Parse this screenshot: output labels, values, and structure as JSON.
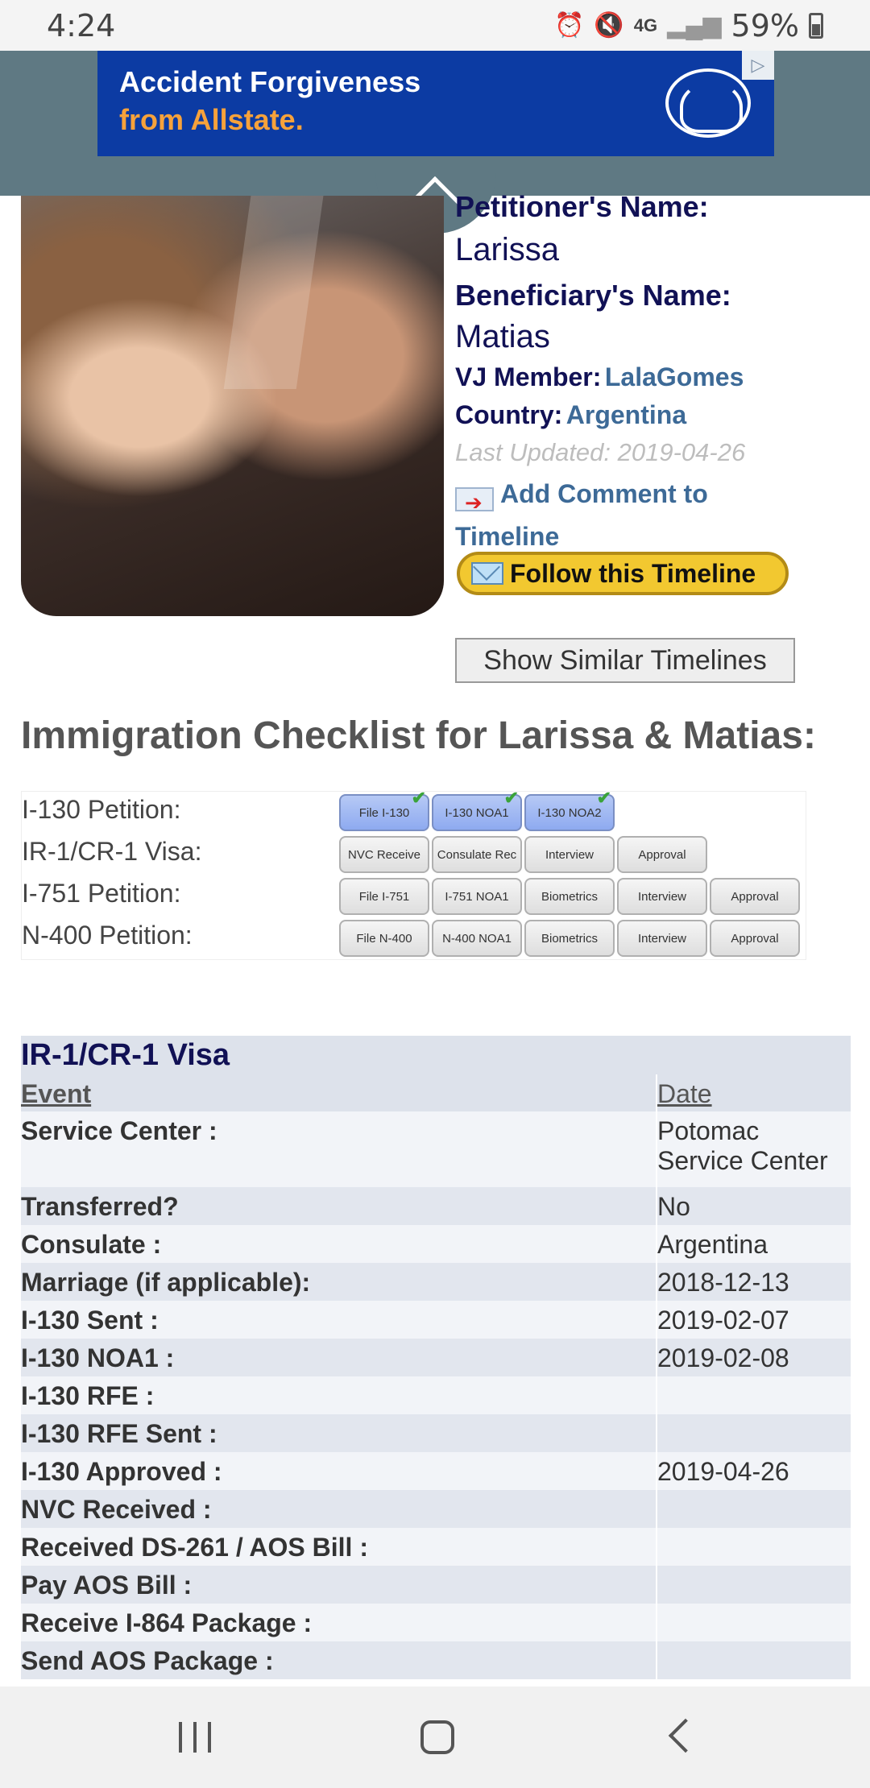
{
  "status": {
    "time": "4:24",
    "battery": "59%",
    "icons": [
      "alarm-icon",
      "mute-icon",
      "4g-lte-icon",
      "signal-icon",
      "battery-icon"
    ]
  },
  "ad": {
    "line1": "Accident Forgiveness",
    "line2": "from Allstate.",
    "brand_color": "#0c3ba3",
    "accent_color": "#f7a23b"
  },
  "profile": {
    "petitioner_label": "Petitioner's Name:",
    "petitioner": "Larissa",
    "beneficiary_label": "Beneficiary's Name:",
    "beneficiary": "Matias",
    "member_label": "VJ Member:",
    "member": "LalaGomes",
    "country_label": "Country:",
    "country": "Argentina",
    "last_updated": "Last Updated: 2019-04-26",
    "add_comment": "Add Comment to Timeline",
    "follow": "Follow this Timeline",
    "similar": "Show Similar Timelines"
  },
  "checklist": {
    "title": "Immigration Checklist for Larissa & Matias:",
    "rows": [
      {
        "label": "I-130 Petition:",
        "steps": [
          {
            "text": "File I-130",
            "done": true
          },
          {
            "text": "I-130 NOA1",
            "done": true
          },
          {
            "text": "I-130 NOA2",
            "done": true
          }
        ]
      },
      {
        "label": "IR-1/CR-1 Visa:",
        "steps": [
          {
            "text": "NVC Receive",
            "done": false
          },
          {
            "text": "Consulate Rec",
            "done": false
          },
          {
            "text": "Interview",
            "done": false
          },
          {
            "text": "Approval",
            "done": false
          }
        ]
      },
      {
        "label": "I-751 Petition:",
        "steps": [
          {
            "text": "File I-751",
            "done": false
          },
          {
            "text": "I-751 NOA1",
            "done": false
          },
          {
            "text": "Biometrics",
            "done": false
          },
          {
            "text": "Interview",
            "done": false
          },
          {
            "text": "Approval",
            "done": false
          }
        ]
      },
      {
        "label": "N-400 Petition:",
        "steps": [
          {
            "text": "File N-400",
            "done": false
          },
          {
            "text": "N-400 NOA1",
            "done": false
          },
          {
            "text": "Biometrics",
            "done": false
          },
          {
            "text": "Interview",
            "done": false
          },
          {
            "text": "Approval",
            "done": false
          }
        ]
      }
    ]
  },
  "events": {
    "title": "IR-1/CR-1 Visa",
    "header": {
      "event": "Event",
      "date": "Date"
    },
    "rows": [
      {
        "event": "Service Center :",
        "date": "Potomac Service Center"
      },
      {
        "event": "Transferred?",
        "date": "No"
      },
      {
        "event": "Consulate :",
        "date": "Argentina"
      },
      {
        "event": "Marriage (if applicable):",
        "date": "2018-12-13"
      },
      {
        "event": "I-130 Sent :",
        "date": "2019-02-07"
      },
      {
        "event": "I-130 NOA1 :",
        "date": "2019-02-08"
      },
      {
        "event": "I-130 RFE :",
        "date": ""
      },
      {
        "event": "I-130 RFE Sent :",
        "date": ""
      },
      {
        "event": "I-130 Approved :",
        "date": "2019-04-26"
      },
      {
        "event": "NVC Received :",
        "date": ""
      },
      {
        "event": "Received DS-261 / AOS Bill :",
        "date": ""
      },
      {
        "event": "Pay AOS Bill :",
        "date": ""
      },
      {
        "event": "Receive I-864 Package :",
        "date": ""
      },
      {
        "event": "Send AOS Package :",
        "date": ""
      }
    ]
  },
  "nav": {
    "icons": [
      "recents-icon",
      "home-icon",
      "back-icon"
    ]
  }
}
